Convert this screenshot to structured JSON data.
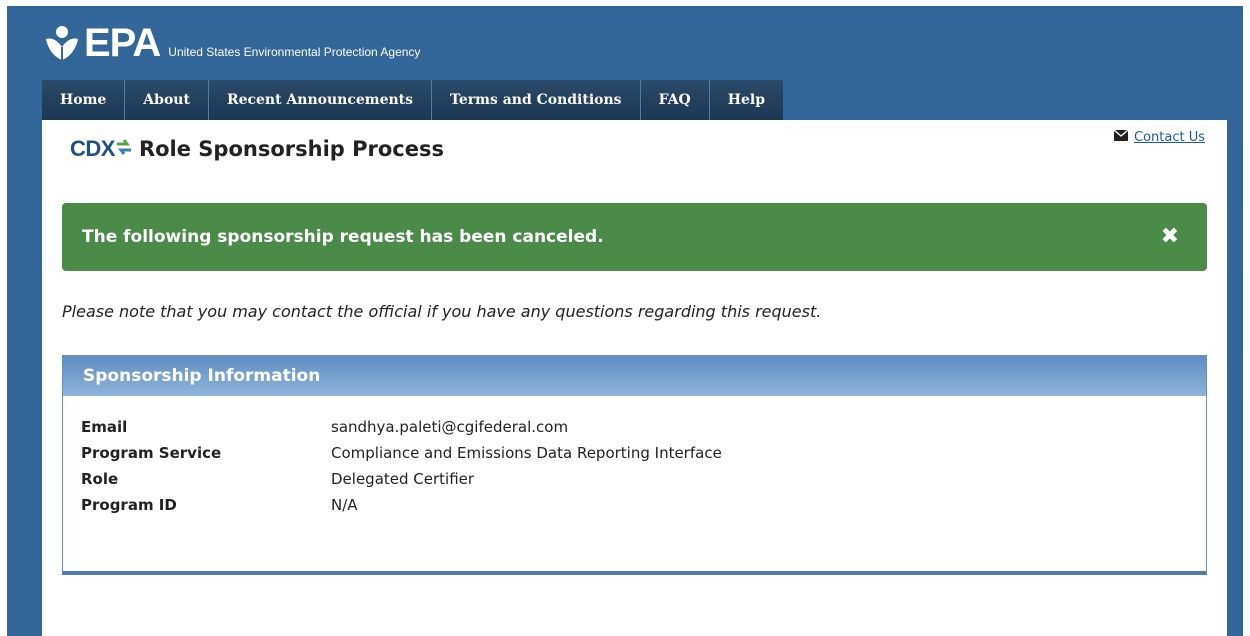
{
  "header": {
    "logo_text": "EPA",
    "agency": "United States Environmental Protection Agency"
  },
  "nav": {
    "items": [
      "Home",
      "About",
      "Recent Announcements",
      "Terms and Conditions",
      "FAQ",
      "Help"
    ]
  },
  "contact": {
    "label": "Contact Us"
  },
  "page": {
    "cdx": "CDX",
    "title": "Role Sponsorship Process"
  },
  "alert": {
    "message": "The following sponsorship request has been canceled.",
    "close": "✖",
    "color": "#4a8b48"
  },
  "note": "Please note that you may contact the official if you have any questions regarding this request.",
  "panel": {
    "title": "Sponsorship Information",
    "rows": [
      {
        "label": "Email",
        "value": "sandhya.paleti@cgifederal.com"
      },
      {
        "label": "Program Service",
        "value": "Compliance and Emissions Data Reporting Interface"
      },
      {
        "label": "Role",
        "value": "Delegated Certifier"
      },
      {
        "label": "Program ID",
        "value": "N/A"
      }
    ]
  }
}
